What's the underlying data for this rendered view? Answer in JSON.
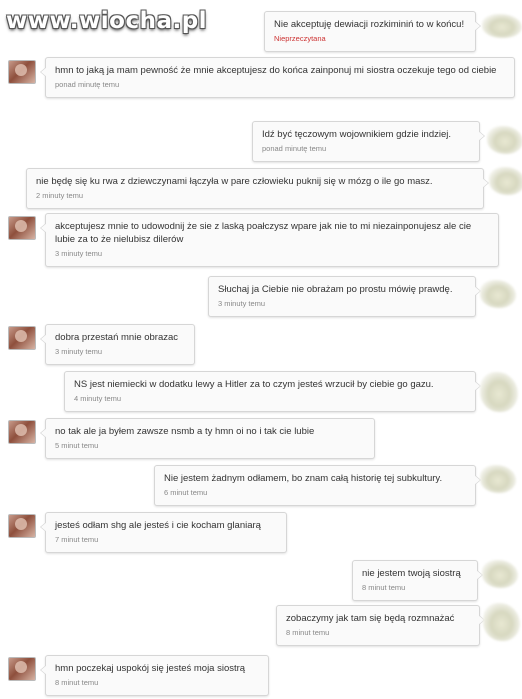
{
  "watermark": "www.wiocha.pl",
  "messages": [
    {
      "side": "right",
      "text": "Nie akceptuję dewiacji rozkiminiń to w końcu!",
      "status": "Nieprzeczytana",
      "time": ""
    },
    {
      "side": "left",
      "text": "hmn to jaką ja mam pewność że mnie akceptujesz do końca zainponuj mi siostra oczekuje tego od ciebie",
      "time": "ponad minutę temu"
    },
    {
      "side": "right",
      "text": "Idź być tęczowym wojownikiem gdzie indziej.",
      "time": "ponad minutę temu"
    },
    {
      "side": "right",
      "text": "nie będę się ku rwa z dziewczynami łączyła w pare człowieku puknij się w mózg o ile go masz.",
      "time": "2 minuty temu"
    },
    {
      "side": "left",
      "text": "akceptujesz mnie to udowodnij że sie z laską poałczysz wpare jak nie to mi niezainponujesz ale cie lubie za to że nielubisz dilerów",
      "time": "3 minuty temu"
    },
    {
      "side": "right",
      "text": "Słuchaj ja Ciebie nie obrażam po prostu mówię prawdę.",
      "time": "3 minuty temu"
    },
    {
      "side": "left",
      "text": "dobra przestań mnie obrazac",
      "time": "3 minuty temu"
    },
    {
      "side": "right",
      "text": "NS jest niemiecki w dodatku lewy a Hitler za to czym jesteś wrzucił by ciebie go gazu.",
      "time": "4 minuty temu"
    },
    {
      "side": "left",
      "text": "no tak ale ja byłem zawsze nsmb a ty hmn oi no i tak cie lubie",
      "time": "5 minut temu"
    },
    {
      "side": "right",
      "text": "Nie jestem żadnym odłamem, bo znam całą historię tej subkultury.",
      "time": "6 minut temu"
    },
    {
      "side": "left",
      "text": "jesteś odłam shg ale jesteś i cie kocham glaniarą",
      "time": "7 minut temu"
    },
    {
      "side": "right",
      "text": "nie jestem twoją siostrą",
      "time": "8 minut temu"
    },
    {
      "side": "right",
      "text": "zobaczymy jak tam się będą rozmnażać",
      "time": "8 minut temu"
    },
    {
      "side": "left",
      "text": "hmn poczekaj uspokój się jesteś moja siostrą",
      "time": "8 minut temu"
    }
  ]
}
